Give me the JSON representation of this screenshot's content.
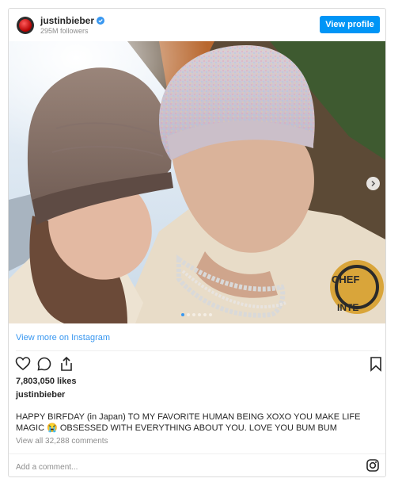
{
  "header": {
    "username": "justinbieber",
    "followers": "295M followers",
    "view_profile_label": "View profile"
  },
  "media": {
    "slide_count": 6,
    "active_slide": 1,
    "jacket_text_1": "CHEF",
    "jacket_text_2": "INTE"
  },
  "links": {
    "view_more": "View more on Instagram"
  },
  "post": {
    "likes": "7,803,050 likes",
    "author": "justinbieber",
    "caption": "HAPPY BIRFDAY (in Japan) TO MY FAVORITE HUMAN BEING XOXO YOU MAKE LIFE MAGIC 😭 OBSESSED WITH EVERYTHING ABOUT YOU. LOVE YOU BUM BUM",
    "comments": "View all 32,288 comments"
  },
  "footer": {
    "add_comment_placeholder": "Add a comment..."
  },
  "colors": {
    "accent": "#0095f6",
    "link": "#3897f0",
    "muted": "#8e8e8e"
  },
  "icons": [
    "verified-badge-icon",
    "heart-icon",
    "comment-icon",
    "share-icon",
    "bookmark-icon",
    "next-arrow-icon",
    "instagram-icon"
  ]
}
